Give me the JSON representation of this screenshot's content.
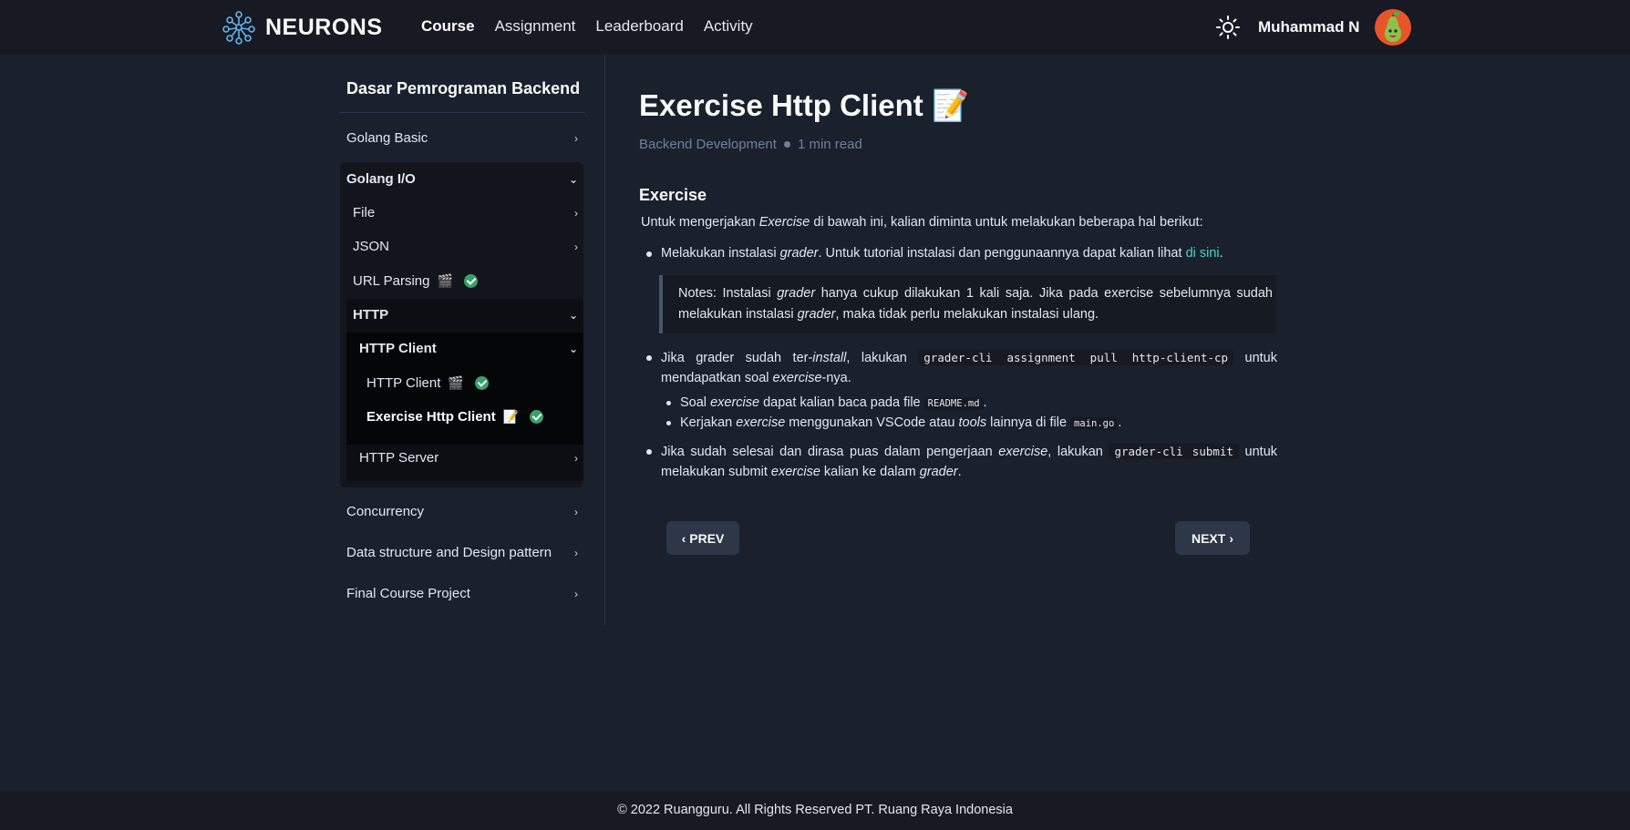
{
  "brand": {
    "name": "NEURONS",
    "logo_icon": "neuron-network-icon"
  },
  "nav": [
    "Course",
    "Assignment",
    "Leaderboard",
    "Activity"
  ],
  "user": {
    "name": "Muhammad N",
    "avatar_icon": "pear-avatar"
  },
  "sidebar": {
    "course_title": "Dasar Pemrograman Backend",
    "items": {
      "golang_basic": "Golang Basic",
      "golang_io": "Golang I/O",
      "file": "File",
      "json": "JSON",
      "url_parsing": "URL Parsing",
      "http": "HTTP",
      "http_client_group": "HTTP Client",
      "http_client": "HTTP Client",
      "exercise_http_client": "Exercise Http Client",
      "http_server": "HTTP Server",
      "concurrency": "Concurrency",
      "data_structure": "Data structure and Design pattern",
      "final_project": "Final Course Project"
    },
    "emoji": {
      "clapper": "🎬",
      "memo": "📝"
    }
  },
  "article": {
    "title": "Exercise Http Client",
    "title_emoji": "📝",
    "category": "Backend Development",
    "read_time": "1 min read",
    "section": "Exercise",
    "intro_a": "Untuk mengerjakan ",
    "intro_b": "Exercise",
    "intro_c": " di bawah ini, kalian diminta untuk melakukan beberapa hal berikut:",
    "b1_a": "Melakukan instalasi ",
    "b1_b": "grader",
    "b1_c": ". Untuk tutorial instalasi dan penggunaannya dapat kalian lihat ",
    "b1_link": "di sini",
    "b1_d": ".",
    "note_a": "Notes: Instalasi ",
    "note_b": "grader",
    "note_c": " hanya cukup dilakukan 1 kali saja. Jika pada exercise sebelumnya sudah melakukan instalasi ",
    "note_d": "grader",
    "note_e": ", maka tidak perlu melakukan instalasi ulang.",
    "b2_a": "Jika grader sudah ter-",
    "b2_b": "install",
    "b2_c": ", lakukan ",
    "b2_code": "grader-cli assignment pull http-client-cp",
    "b2_d": " untuk",
    "b2_e": "mendapatkan soal ",
    "b2_f": "exercise",
    "b2_g": "-nya.",
    "s1_a": "Soal ",
    "s1_b": "exercise",
    "s1_c": " dapat kalian baca pada file ",
    "s1_code": "README.md",
    "s1_d": ".",
    "s2_a": "Kerjakan ",
    "s2_b": "exercise",
    "s2_c": " menggunakan VSCode atau ",
    "s2_d": "tools",
    "s2_e": " lainnya di file ",
    "s2_code": "main.go",
    "s2_f": ".",
    "b3_a": "Jika sudah selesai dan dirasa puas dalam pengerjaan ",
    "b3_b": "exercise",
    "b3_c": ", lakukan ",
    "b3_code": "grader-cli submit",
    "b3_d": " untuk",
    "b3_e": "melakukan submit ",
    "b3_f": "exercise",
    "b3_g": " kalian ke dalam ",
    "b3_h": "grader",
    "b3_i": "."
  },
  "pager": {
    "prev": "PREV",
    "next": "NEXT"
  },
  "footer": "© 2022 Ruangguru. All Rights Reserved PT. Ruang Raya Indonesia",
  "colors": {
    "background": "#1a202c",
    "header": "#171923",
    "link": "#4fd1c5",
    "check": "#38a169"
  }
}
